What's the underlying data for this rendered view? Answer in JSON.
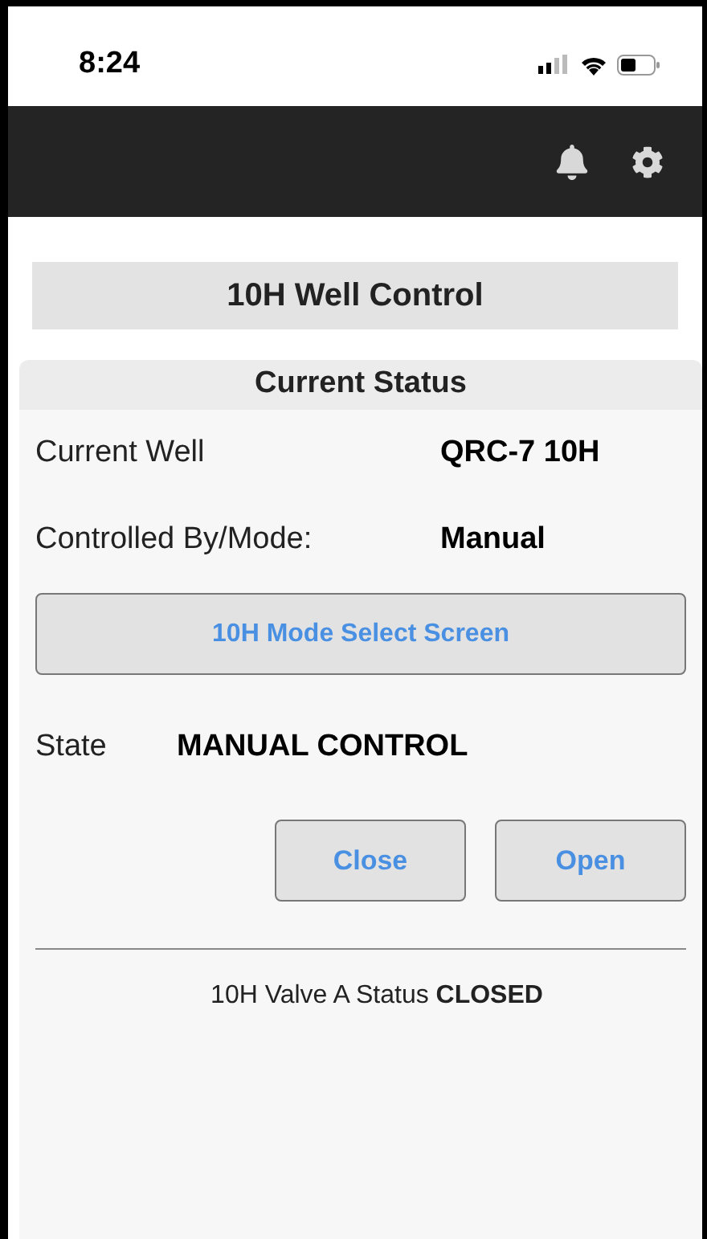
{
  "status_bar": {
    "time": "8:24"
  },
  "page_title": "10H Well Control",
  "panel": {
    "title": "Current Status",
    "fields": [
      {
        "label": "Current Well",
        "value": "QRC-7 10H"
      },
      {
        "label": "Controlled By/Mode:",
        "value": "Manual"
      }
    ],
    "mode_button": "10H Mode Select Screen",
    "state": {
      "label": "State",
      "value": "MANUAL CONTROL"
    },
    "actions": [
      "Close",
      "Open"
    ],
    "valve_status": "10H Valve A Status **CLOSED**"
  }
}
